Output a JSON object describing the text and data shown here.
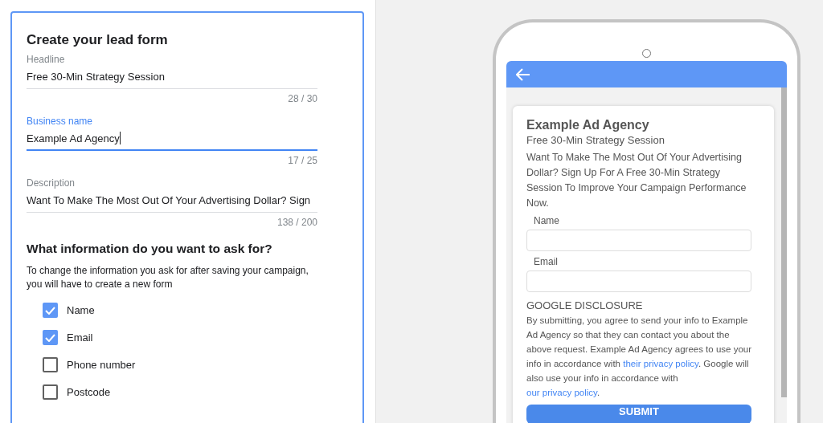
{
  "form": {
    "title": "Create your lead form",
    "fields": [
      {
        "label": "Headline",
        "value": "Free 30-Min Strategy Session",
        "counter": "28 / 30",
        "focused": false
      },
      {
        "label": "Business name",
        "value": "Example Ad Agency",
        "counter": "17 / 25",
        "focused": true
      },
      {
        "label": "Description",
        "value": "Want To Make The Most Out Of Your Advertising Dollar? Sign",
        "counter": "138 / 200",
        "focused": false
      }
    ],
    "section_title": "What information do you want to ask for?",
    "section_note": "To change the information you ask for after saving your campaign, you will have to create a new form",
    "options": [
      {
        "label": "Name",
        "checked": true
      },
      {
        "label": "Email",
        "checked": true
      },
      {
        "label": "Phone number",
        "checked": false
      },
      {
        "label": "Postcode",
        "checked": false
      }
    ]
  },
  "preview": {
    "business_name": "Example Ad Agency",
    "headline": "Free 30-Min Strategy Session",
    "description": "Want To Make The Most Out Of Your Advertising Dollar? Sign Up For A Free 30-Min Strategy Session To Improve Your Campaign Performance Now.",
    "fields": [
      {
        "label": "Name"
      },
      {
        "label": "Email"
      }
    ],
    "disclosure_title": "GOOGLE DISCLOSURE",
    "disclosure": [
      {
        "kind": "text",
        "text": "By submitting, you agree to send your info to Example Ad Agency so that they can contact you about the above request. Example Ad Agency agrees to use your info in accordance with "
      },
      {
        "kind": "link",
        "text": "their privacy policy"
      },
      {
        "kind": "text",
        "text": ". Google will also use your info in accordance with "
      },
      {
        "kind": "link",
        "text": "our privacy policy"
      },
      {
        "kind": "text",
        "text": "."
      }
    ],
    "submit": "SUBMIT"
  }
}
